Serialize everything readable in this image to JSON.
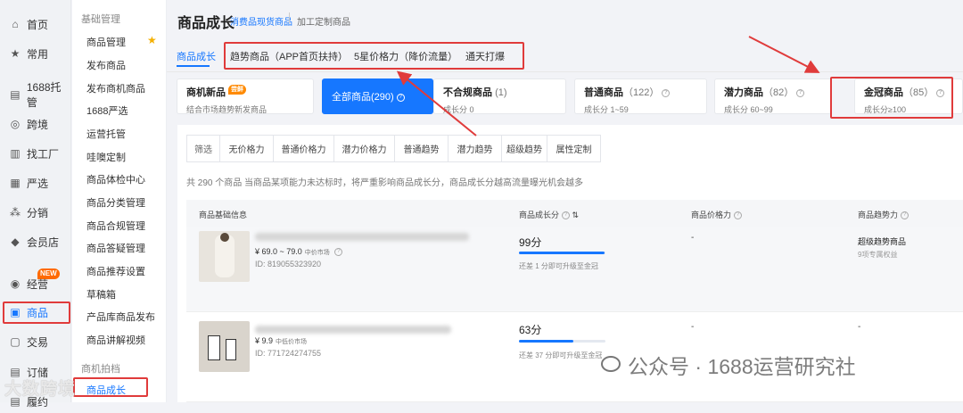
{
  "left_nav": {
    "items": [
      {
        "label": "首页",
        "icon": "home-icon",
        "glyph": "⌂"
      },
      {
        "label": "常用",
        "icon": "star-icon",
        "glyph": "★"
      },
      {
        "label": "1688托管",
        "icon": "briefcase-icon",
        "glyph": "▤"
      },
      {
        "label": "跨境",
        "icon": "globe-icon",
        "glyph": "◎"
      },
      {
        "label": "找工厂",
        "icon": "factory-icon",
        "glyph": "▥"
      },
      {
        "label": "严选",
        "icon": "shop-icon",
        "glyph": "▦"
      },
      {
        "label": "分销",
        "icon": "network-icon",
        "glyph": "⁂"
      },
      {
        "label": "会员店",
        "icon": "diamond-icon",
        "glyph": "◆"
      },
      {
        "label": "经营",
        "icon": "chart-icon",
        "glyph": "◉"
      },
      {
        "label": "商品",
        "icon": "product-icon",
        "glyph": "▣"
      },
      {
        "label": "交易",
        "icon": "trade-icon",
        "glyph": "▢"
      },
      {
        "label": "订储",
        "icon": "storage-icon",
        "glyph": "▤"
      },
      {
        "label": "履约",
        "icon": "delivery-icon",
        "glyph": "▤"
      }
    ],
    "new_badge": "NEW"
  },
  "sub_nav": {
    "section1": "基础管理",
    "items": [
      "商品管理",
      "发布商品",
      "发布商机商品",
      "1688严选",
      "运营托管",
      "哇噢定制",
      "商品体检中心",
      "商品分类管理",
      "商品合规管理",
      "商品答疑管理",
      "商品推荐设置",
      "草稿箱",
      "产品库商品发布",
      "商品讲解视频"
    ],
    "section2": "商机拍档",
    "active_item": "商品成长"
  },
  "header": {
    "title": "商品成长",
    "link1": "消费品现货商品",
    "link2": "加工定制商品"
  },
  "tabs": {
    "active": "商品成长",
    "others": [
      "趋势商品（APP首页扶持）",
      "5星价格力（降价流量）",
      "通天打爆"
    ]
  },
  "cards": [
    {
      "title": "商机新品",
      "badge": "尝鲜",
      "sub": "结合市场趋势新发商品"
    },
    {
      "title": "全部商品(290)",
      "selected": true
    },
    {
      "title": "不合规商品",
      "count": "(1)",
      "sub": "成长分 0"
    },
    {
      "title": "普通商品",
      "count": "（122）",
      "sub": "成长分 1~59"
    },
    {
      "title": "潜力商品",
      "count": "（82）",
      "sub": "成长分 60~99"
    },
    {
      "title": "金冠商品",
      "count": "（85）",
      "sub": "成长分≥100"
    }
  ],
  "filters": {
    "label": "筛选",
    "buttons": [
      "无价格力",
      "普通价格力",
      "潜力价格力",
      "普通趋势",
      "潜力趋势",
      "超级趋势",
      "属性定制"
    ]
  },
  "note": "共 290 个商品 当商品某项能力未达标时，将严重影响商品成长分，商品成长分越高流量曝光机会越多",
  "table": {
    "headers": [
      "商品基础信息",
      "商品成长分",
      "商品价格力",
      "商品趋势力"
    ],
    "rows": [
      {
        "price": "¥ 69.0 ~ 79.0",
        "market": "中价市场",
        "id": "ID: 819055323920",
        "score": "99分",
        "score_progress": 0.99,
        "hint": "还差 1 分即可升级至金冠",
        "price_power": "-",
        "trend": "超级趋势商品",
        "trend_sub": "9项专属权益"
      },
      {
        "price": "¥ 9.9",
        "market": "中低价市场",
        "id": "ID: 771724274755",
        "score": "63分",
        "score_progress": 0.63,
        "hint": "还差 37 分即可升级至金冠",
        "price_power": "-",
        "trend": "-",
        "trend_sub": ""
      }
    ]
  },
  "watermark": {
    "text": "公众号 · 1688运营研究社",
    "text2": "大数跨境"
  },
  "colors": {
    "accent": "#1677ff",
    "annotation_red": "#e03b3b",
    "badge_orange": "#ff8a00"
  }
}
